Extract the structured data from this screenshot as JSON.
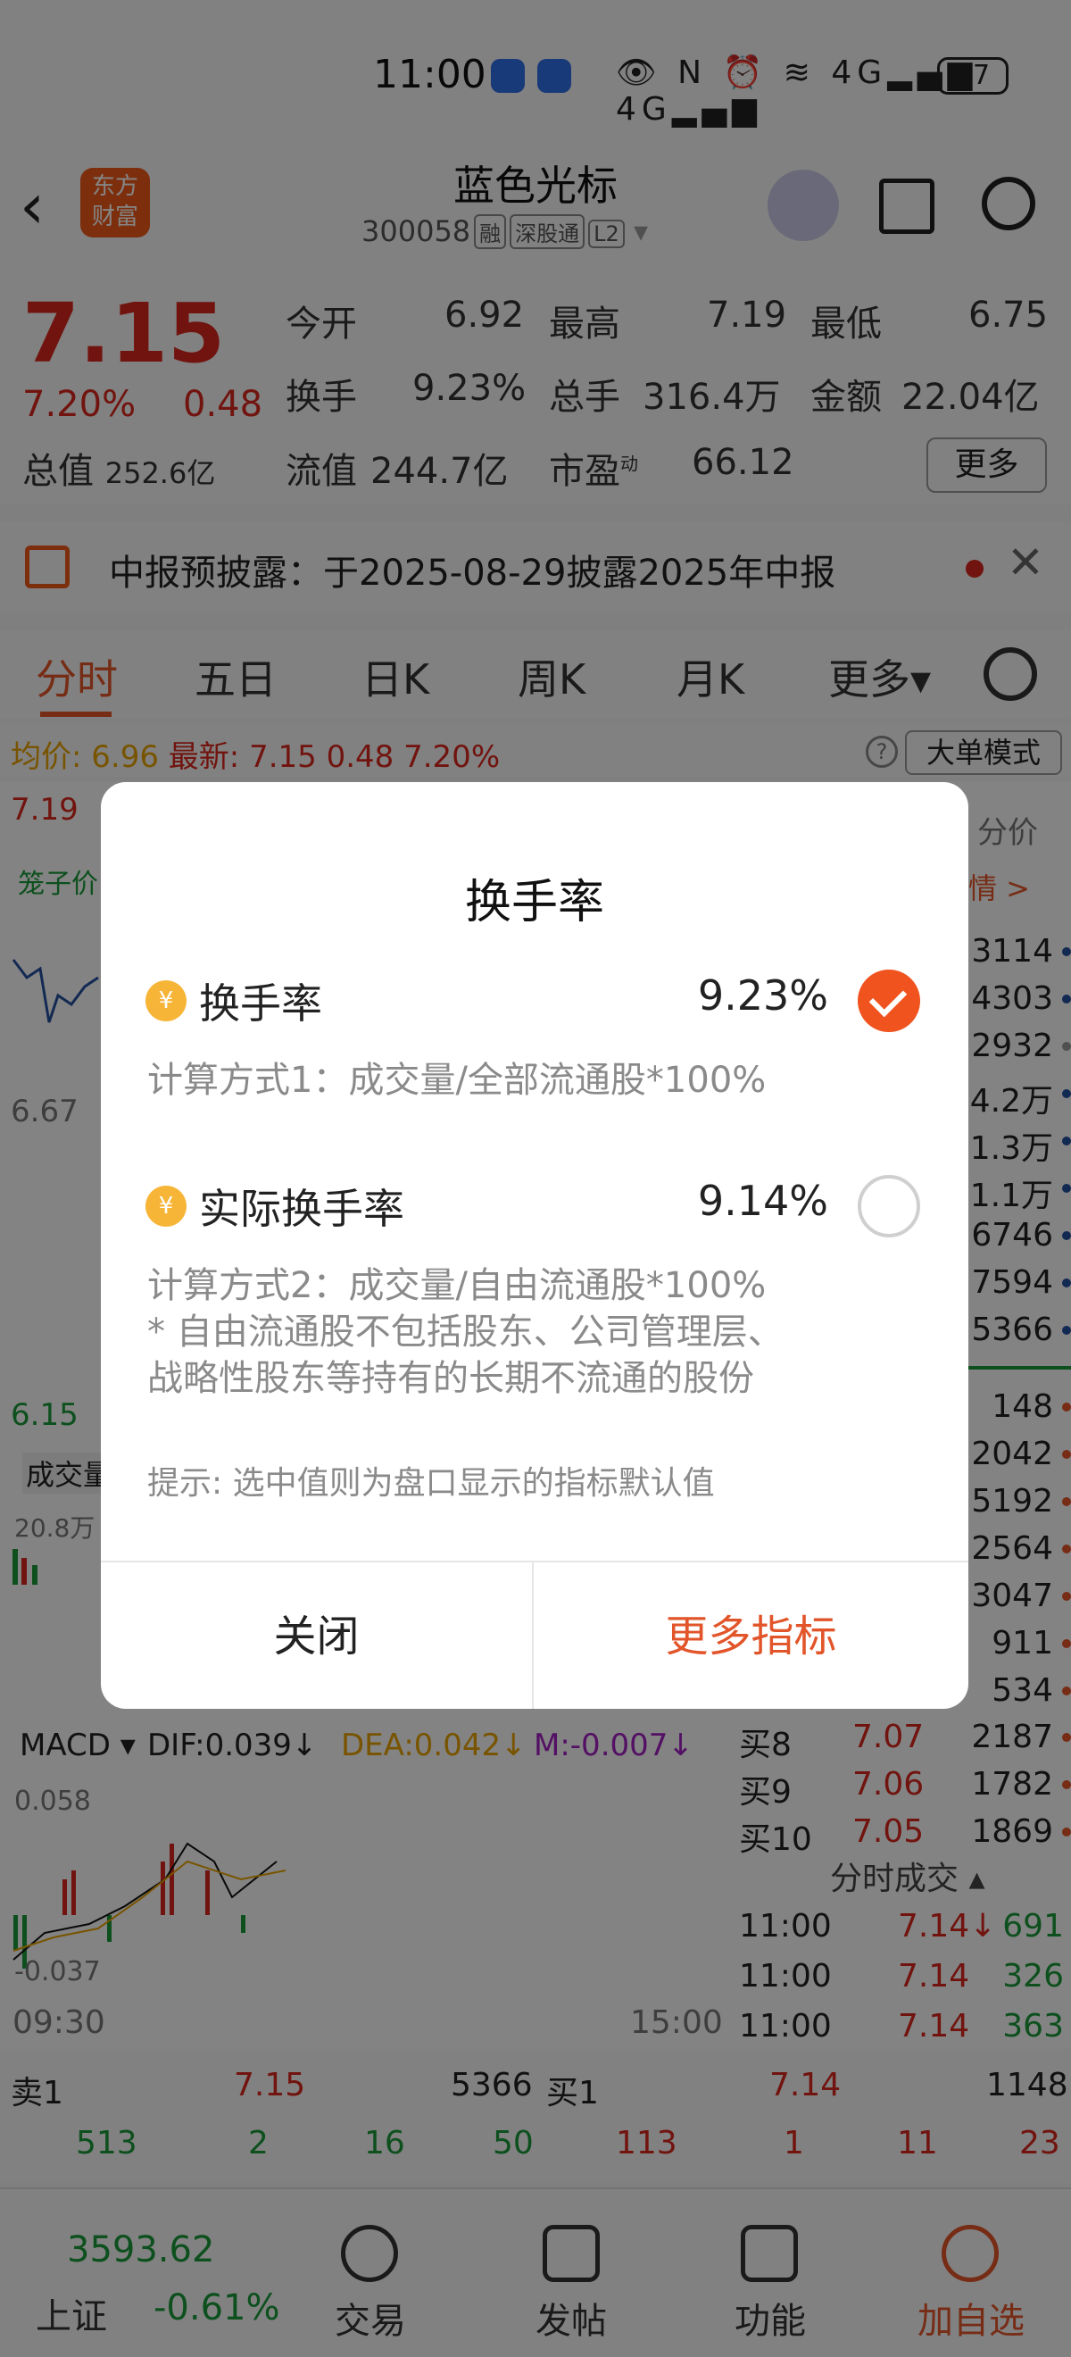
{
  "status": {
    "time": "11:00",
    "network1": "4G",
    "network2": "4G",
    "battery": "57"
  },
  "header": {
    "logo": [
      "东方",
      "财富"
    ],
    "name": "蓝色光标",
    "code": "300058",
    "tags": [
      "融",
      "深股通",
      "L2"
    ]
  },
  "quote": {
    "price": "7.15",
    "pct": "7.20%",
    "chg": "0.48",
    "open_label": "今开",
    "open": "6.92",
    "high_label": "最高",
    "high": "7.19",
    "low_label": "最低",
    "low": "6.75",
    "turnover_label": "换手",
    "turnover": "9.23%",
    "volume_label": "总手",
    "volume": "316.4万",
    "amount_label": "金额",
    "amount": "22.04亿",
    "mktcap_label": "总值",
    "mktcap": "252.6亿",
    "float_label": "流值",
    "float_cap": "244.7亿",
    "pe_label": "市盈",
    "pe_sup": "动",
    "pe": "66.12",
    "more": "更多"
  },
  "notice": {
    "text": "中报预披露：于2025-08-29披露2025年中报"
  },
  "tabs": [
    "分时",
    "五日",
    "日K",
    "周K",
    "月K",
    "更多▾"
  ],
  "avgbar": {
    "avg_label": "均价:",
    "avg": "6.96",
    "latest_label": "最新:",
    "latest": "7.15",
    "chg": "0.48",
    "pct": "7.20%",
    "big_order": "大单模式",
    "help": "?"
  },
  "chart": {
    "top_price": "7.19",
    "cage_label": "笼子价",
    "mid_price": "6.67",
    "low_price": "6.15",
    "vol_label": "成交量",
    "vol_max": "20.8万",
    "macd_label": "MACD ▾",
    "dif": "DIF:0.039↓",
    "dea": "DEA:0.042↓",
    "m": "M:-0.007↓",
    "macd_top": "0.058",
    "macd_bottom": "-0.037",
    "time_start": "09:30",
    "time_end": "15:00"
  },
  "orderbook": {
    "header": "分价",
    "detail_link": "情 >",
    "asks": [
      "3114",
      "4303",
      "2932",
      "4.2万",
      "1.3万",
      "1.1万",
      "6746",
      "7594",
      "5366"
    ],
    "bids_partial": [
      "148",
      "2042",
      "5192",
      "2564",
      "3047",
      "911",
      "534"
    ],
    "bids": [
      {
        "label": "买8",
        "price": "7.07",
        "vol": "2187"
      },
      {
        "label": "买9",
        "price": "7.06",
        "vol": "1782"
      },
      {
        "label": "买10",
        "price": "7.05",
        "vol": "1869"
      }
    ],
    "trades_title": "分时成交 ▴",
    "trades": [
      {
        "time": "11:00",
        "price": "7.14↓",
        "vol": "691"
      },
      {
        "time": "11:00",
        "price": "7.14",
        "vol": "326"
      },
      {
        "time": "11:00",
        "price": "7.14",
        "vol": "363"
      }
    ]
  },
  "book": {
    "sell_label": "卖1",
    "sell_price": "7.15",
    "sell_vol": "5366",
    "buy_label": "买1",
    "buy_price": "7.14",
    "buy_vol": "1148",
    "sell_row": [
      "513",
      "2",
      "16",
      "50"
    ],
    "buy_row": [
      "113",
      "1",
      "11",
      "23"
    ]
  },
  "bottom_nav": {
    "index_value": "3593.62",
    "index_name": "上证",
    "index_pct": "-0.61%",
    "items": [
      "交易",
      "发帖",
      "功能",
      "加自选"
    ]
  },
  "dialog": {
    "title": "换手率",
    "options": [
      {
        "label": "换手率",
        "value": "9.23%",
        "selected": true
      },
      {
        "label": "实际换手率",
        "value": "9.14%",
        "selected": false
      }
    ],
    "desc1": "计算方式1：成交量/全部流通股*100%",
    "desc2": "计算方式2：成交量/自由流通股*100%",
    "desc2_note1": " * 自由流通股不包括股东、公司管理层、",
    "desc2_note2": "战略性股东等持有的长期不流通的股份",
    "hint": "提示: 选中值则为盘口显示的指标默认值",
    "close": "关闭",
    "more": "更多指标",
    "coin_icon": "¥"
  },
  "colors": {
    "up": "#d9281e",
    "down": "#1a9a3a",
    "accent": "#e2552a",
    "coin": "#f7b538"
  }
}
